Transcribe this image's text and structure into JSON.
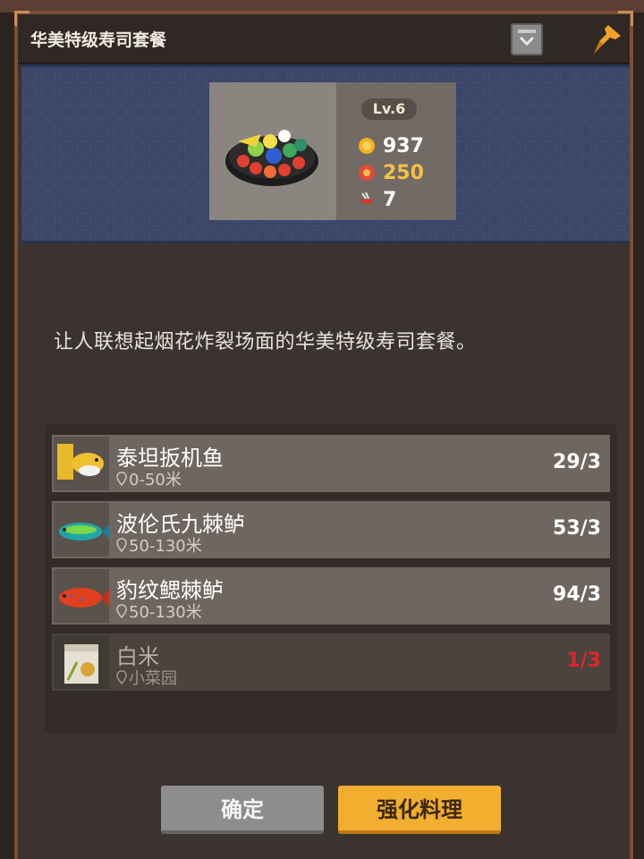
{
  "window": {
    "title": "华美特级寿司套餐"
  },
  "dish": {
    "level": "Lv.6",
    "price": "937",
    "energy": "250",
    "count": "7"
  },
  "description": "让人联想起烟花炸裂场面的华美特级寿司套餐。",
  "ingredients": [
    {
      "name": "泰坦扳机鱼",
      "location": "0-50米",
      "count": "29/3"
    },
    {
      "name": "波伦氏九棘鲈",
      "location": "50-130米",
      "count": "53/3"
    },
    {
      "name": "豹纹鳃棘鲈",
      "location": "50-130米",
      "count": "94/3"
    },
    {
      "name": "白米",
      "location": "小菜园",
      "count": "1/3"
    }
  ],
  "buttons": {
    "confirm": "确定",
    "enhance": "强化料理"
  },
  "colors": {
    "accent": "#f2ae2e",
    "banner": "#3b4668",
    "shortage": "#e02626"
  }
}
